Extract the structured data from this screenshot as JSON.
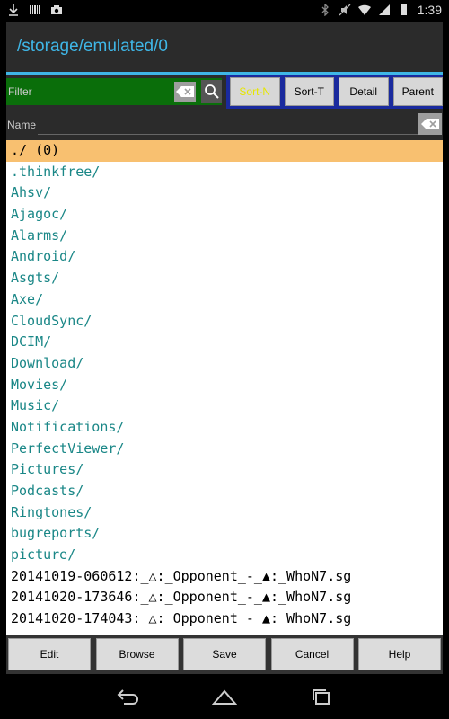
{
  "status": {
    "time": "1:39",
    "icons": [
      "download-icon",
      "barcode-icon",
      "camera-icon",
      "bluetooth-icon",
      "mute-icon",
      "wifi-icon",
      "signal-icon",
      "battery-icon"
    ]
  },
  "title": "/storage/emulated/0",
  "filter": {
    "label": "Filter",
    "value": ""
  },
  "sort_buttons": [
    {
      "label": "Sort-N",
      "active": true
    },
    {
      "label": "Sort-T",
      "active": false
    },
    {
      "label": "Detail",
      "active": false
    },
    {
      "label": "Parent",
      "active": false
    }
  ],
  "name": {
    "label": "Name",
    "value": ""
  },
  "files": [
    {
      "name": "./ (0)",
      "type": "selected"
    },
    {
      "name": ".thinkfree/",
      "type": "dir"
    },
    {
      "name": "Ahsv/",
      "type": "dir"
    },
    {
      "name": "Ajagoc/",
      "type": "dir"
    },
    {
      "name": "Alarms/",
      "type": "dir"
    },
    {
      "name": "Android/",
      "type": "dir"
    },
    {
      "name": "Asgts/",
      "type": "dir"
    },
    {
      "name": "Axe/",
      "type": "dir"
    },
    {
      "name": "CloudSync/",
      "type": "dir"
    },
    {
      "name": "DCIM/",
      "type": "dir"
    },
    {
      "name": "Download/",
      "type": "dir"
    },
    {
      "name": "Movies/",
      "type": "dir"
    },
    {
      "name": "Music/",
      "type": "dir"
    },
    {
      "name": "Notifications/",
      "type": "dir"
    },
    {
      "name": "PerfectViewer/",
      "type": "dir"
    },
    {
      "name": "Pictures/",
      "type": "dir"
    },
    {
      "name": "Podcasts/",
      "type": "dir"
    },
    {
      "name": "Ringtones/",
      "type": "dir"
    },
    {
      "name": "bugreports/",
      "type": "dir"
    },
    {
      "name": "picture/",
      "type": "dir"
    },
    {
      "name": "20141019-060612:_△:_Opponent_-_▲:_WhoN7.sg",
      "type": "file"
    },
    {
      "name": "20141020-173646:_△:_Opponent_-_▲:_WhoN7.sg",
      "type": "file"
    },
    {
      "name": "20141020-174043:_△:_Opponent_-_▲:_WhoN7.sg",
      "type": "file"
    }
  ],
  "bottom_buttons": [
    {
      "label": "Edit"
    },
    {
      "label": "Browse"
    },
    {
      "label": "Save"
    },
    {
      "label": "Cancel"
    },
    {
      "label": "Help"
    }
  ],
  "colors": {
    "accent": "#3fb6e6",
    "dir_text": "#1a8787",
    "selected_bg": "#f8c070",
    "filter_bg": "#0a6e0a",
    "sort_bg": "#1a2a9e",
    "active_sort_text": "#e6e600"
  }
}
